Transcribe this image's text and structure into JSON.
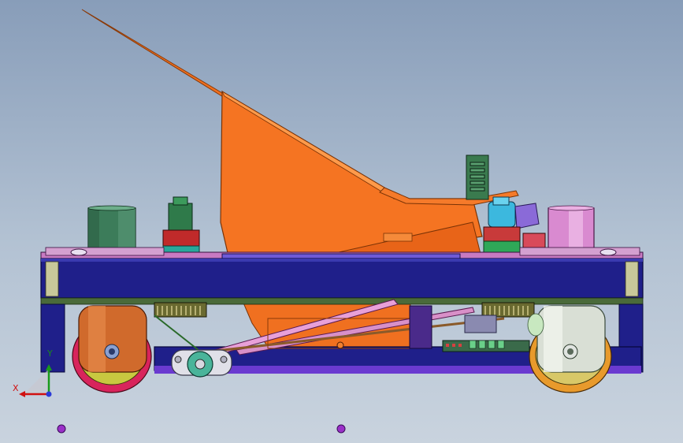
{
  "app": {
    "name": ""
  },
  "triad": {
    "x_label": "X",
    "y_label": "Y",
    "x_color": "#d01010",
    "y_color": "#1a9a1a",
    "z_color": "#2a3ad8"
  },
  "colors": {
    "viewport_top": "#889db9",
    "viewport_bottom": "#c9d3de",
    "frame": "#1f1f8a",
    "orange_hopper": "#f0701c",
    "wheel_tire": "#d8245c",
    "wheel_hub_left": "#d06a2c",
    "wheel_hub_right": "#d9dfd5",
    "motor_green": "#3c7c5a",
    "motor_pink": "#d98ad0",
    "motor_cyan": "#3cb8de",
    "pcb_green": "#3a6a4a"
  },
  "icons": [
    "coordinate-triad-icon",
    "reference-point-icon"
  ]
}
